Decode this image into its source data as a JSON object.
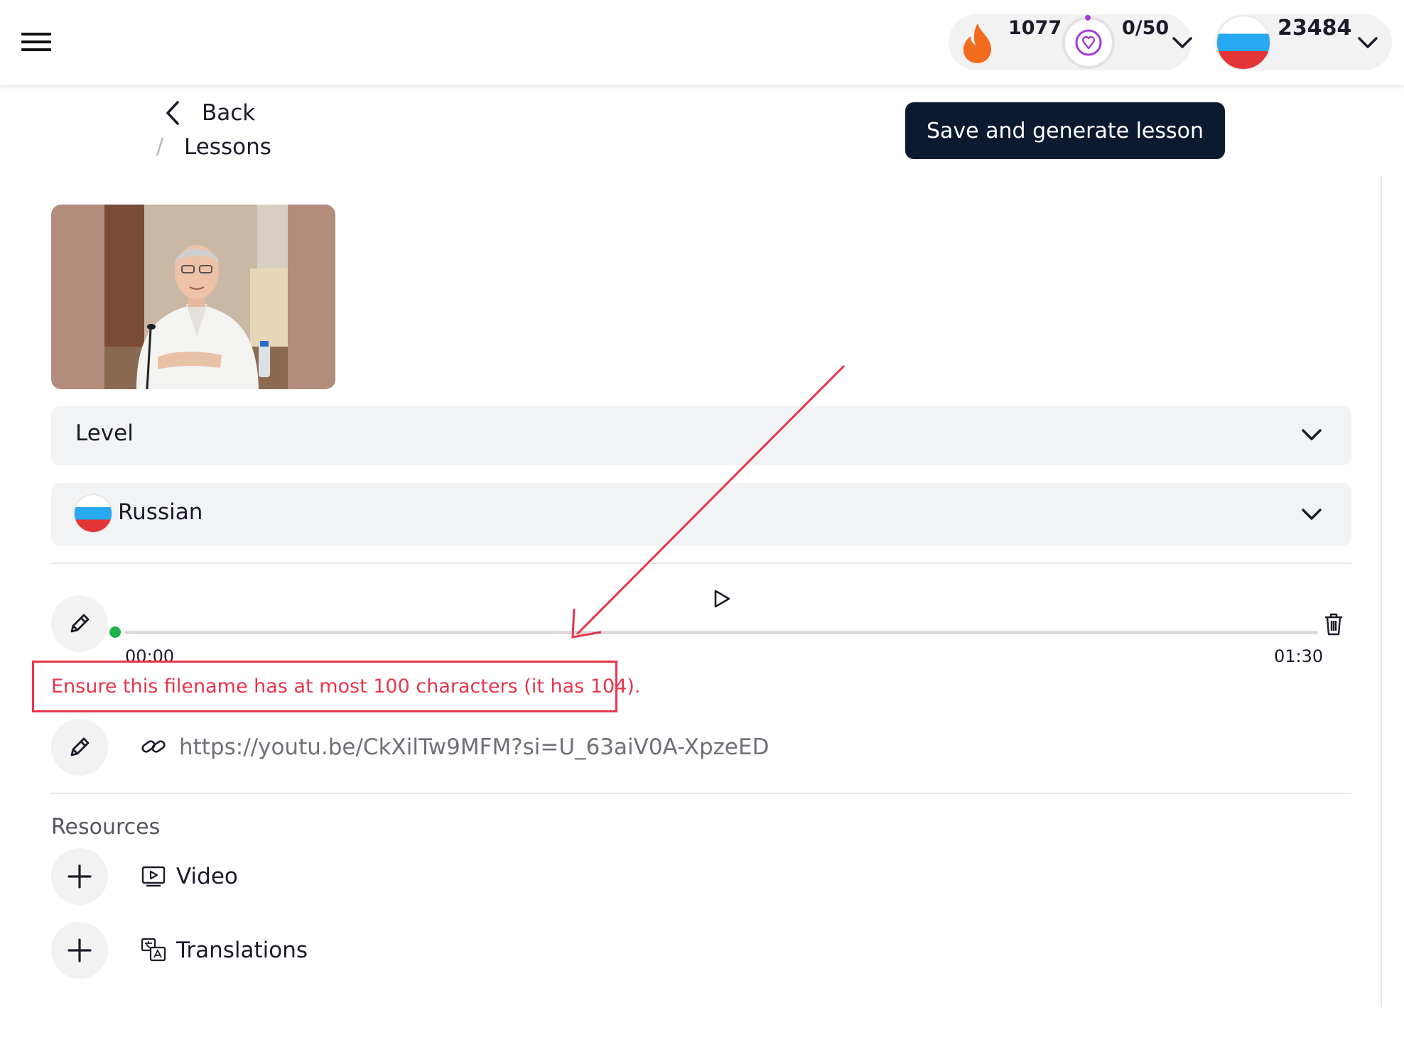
{
  "header": {
    "streak_count": "1077",
    "goal_progress": "0/50",
    "points": "23484",
    "icons": {
      "menu": "hamburger-icon",
      "streak": "flame-icon",
      "goal": "heart-pin-icon",
      "dropdown": "chevron-down-icon"
    },
    "colors": {
      "flame": "#f36b1c",
      "goal": "#a23cd6"
    }
  },
  "breadcrumb": {
    "back_label": "Back",
    "separator": "/",
    "current": "Lessons"
  },
  "toolbar": {
    "save_label": "Save and generate lesson"
  },
  "form": {
    "level_select": {
      "label": "Level"
    },
    "language_select": {
      "label": "Russian",
      "flag": "russia-flag-icon"
    }
  },
  "audio": {
    "start_time": "00:00",
    "end_time": "01:30",
    "progress": 0.0,
    "error": "Ensure this filename has at most 100 characters (it has 104)."
  },
  "link": {
    "url": "https://youtu.be/CkXilTw9MFM?si=U_63aiV0A-XpzeED"
  },
  "resources": {
    "title": "Resources",
    "items": [
      {
        "label": "Video",
        "icon": "video-icon"
      },
      {
        "label": "Translations",
        "icon": "translate-icon"
      }
    ]
  },
  "annotation": {
    "color": "#e8354b"
  }
}
